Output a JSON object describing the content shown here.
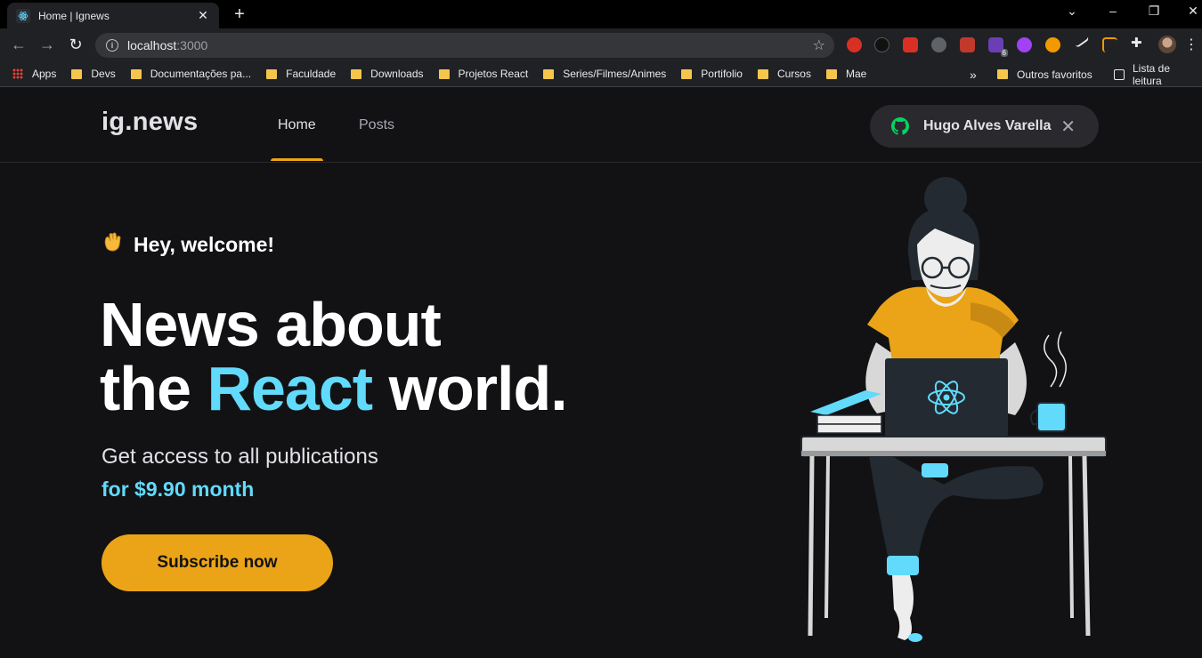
{
  "browser": {
    "tab_title": "Home | Ignews",
    "url_host": "localhost",
    "url_port": ":3000",
    "bookmarks": [
      {
        "label": "Apps",
        "icon": "apps-icon"
      },
      {
        "label": "Devs",
        "icon": "folder-icon"
      },
      {
        "label": "Documentações pa...",
        "icon": "folder-icon"
      },
      {
        "label": "Faculdade",
        "icon": "folder-icon"
      },
      {
        "label": "Downloads",
        "icon": "folder-icon"
      },
      {
        "label": "Projetos React",
        "icon": "folder-icon"
      },
      {
        "label": "Series/Filmes/Animes",
        "icon": "folder-icon"
      },
      {
        "label": "Portifolio",
        "icon": "folder-icon"
      },
      {
        "label": "Cursos",
        "icon": "folder-icon"
      },
      {
        "label": "Mae",
        "icon": "folder-icon"
      }
    ],
    "bookmarks_overflow": "»",
    "other_bookmarks": "Outros favoritos",
    "reading_list": "Lista de leitura",
    "extension_badge": "6"
  },
  "site": {
    "logo": "ig.news",
    "nav": [
      {
        "label": "Home",
        "active": true
      },
      {
        "label": "Posts",
        "active": false
      }
    ],
    "user_name": "Hugo Alves Varella",
    "welcome": "Hey, welcome!",
    "headline_line1": "News about",
    "headline_the": "the",
    "headline_accent": "React",
    "headline_end": "world.",
    "subtitle": "Get access to all publications",
    "price": "for $9.90 month",
    "cta": "Subscribe now"
  },
  "colors": {
    "background": "#121214",
    "accent_yellow": "#eba417",
    "accent_cyan": "#61dafb",
    "github_green": "#04d361"
  }
}
